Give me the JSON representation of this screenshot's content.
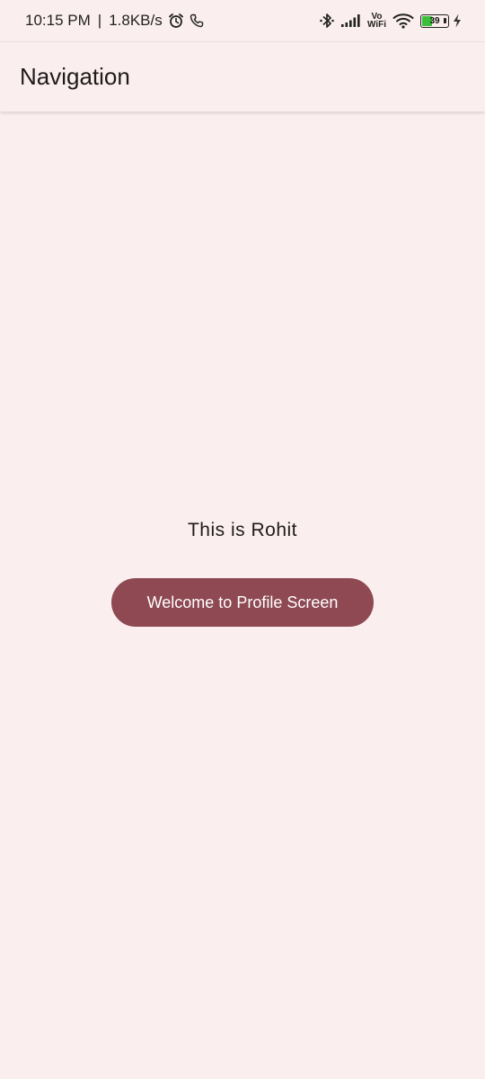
{
  "status_bar": {
    "time": "10:15 PM",
    "separator": "|",
    "network_speed": "1.8KB/s",
    "left_icons": [
      "alarm-icon",
      "phone-call-icon"
    ],
    "right_icons": [
      "bluetooth-icon",
      "signal-icon",
      "vowifi-icon",
      "wifi-icon",
      "battery-icon",
      "charging-icon"
    ],
    "vowifi_top": "Vo",
    "vowifi_bottom": "WiFi",
    "battery_percent": "39",
    "battery_level": 0.39
  },
  "app_bar": {
    "title": "Navigation"
  },
  "main": {
    "text": "This is Rohit",
    "button_label": "Welcome to Profile Screen"
  },
  "colors": {
    "background": "#FBEEEE",
    "button": "#8E4952",
    "button_text": "#FFFFFF",
    "battery_fill": "#3BBF3B"
  }
}
